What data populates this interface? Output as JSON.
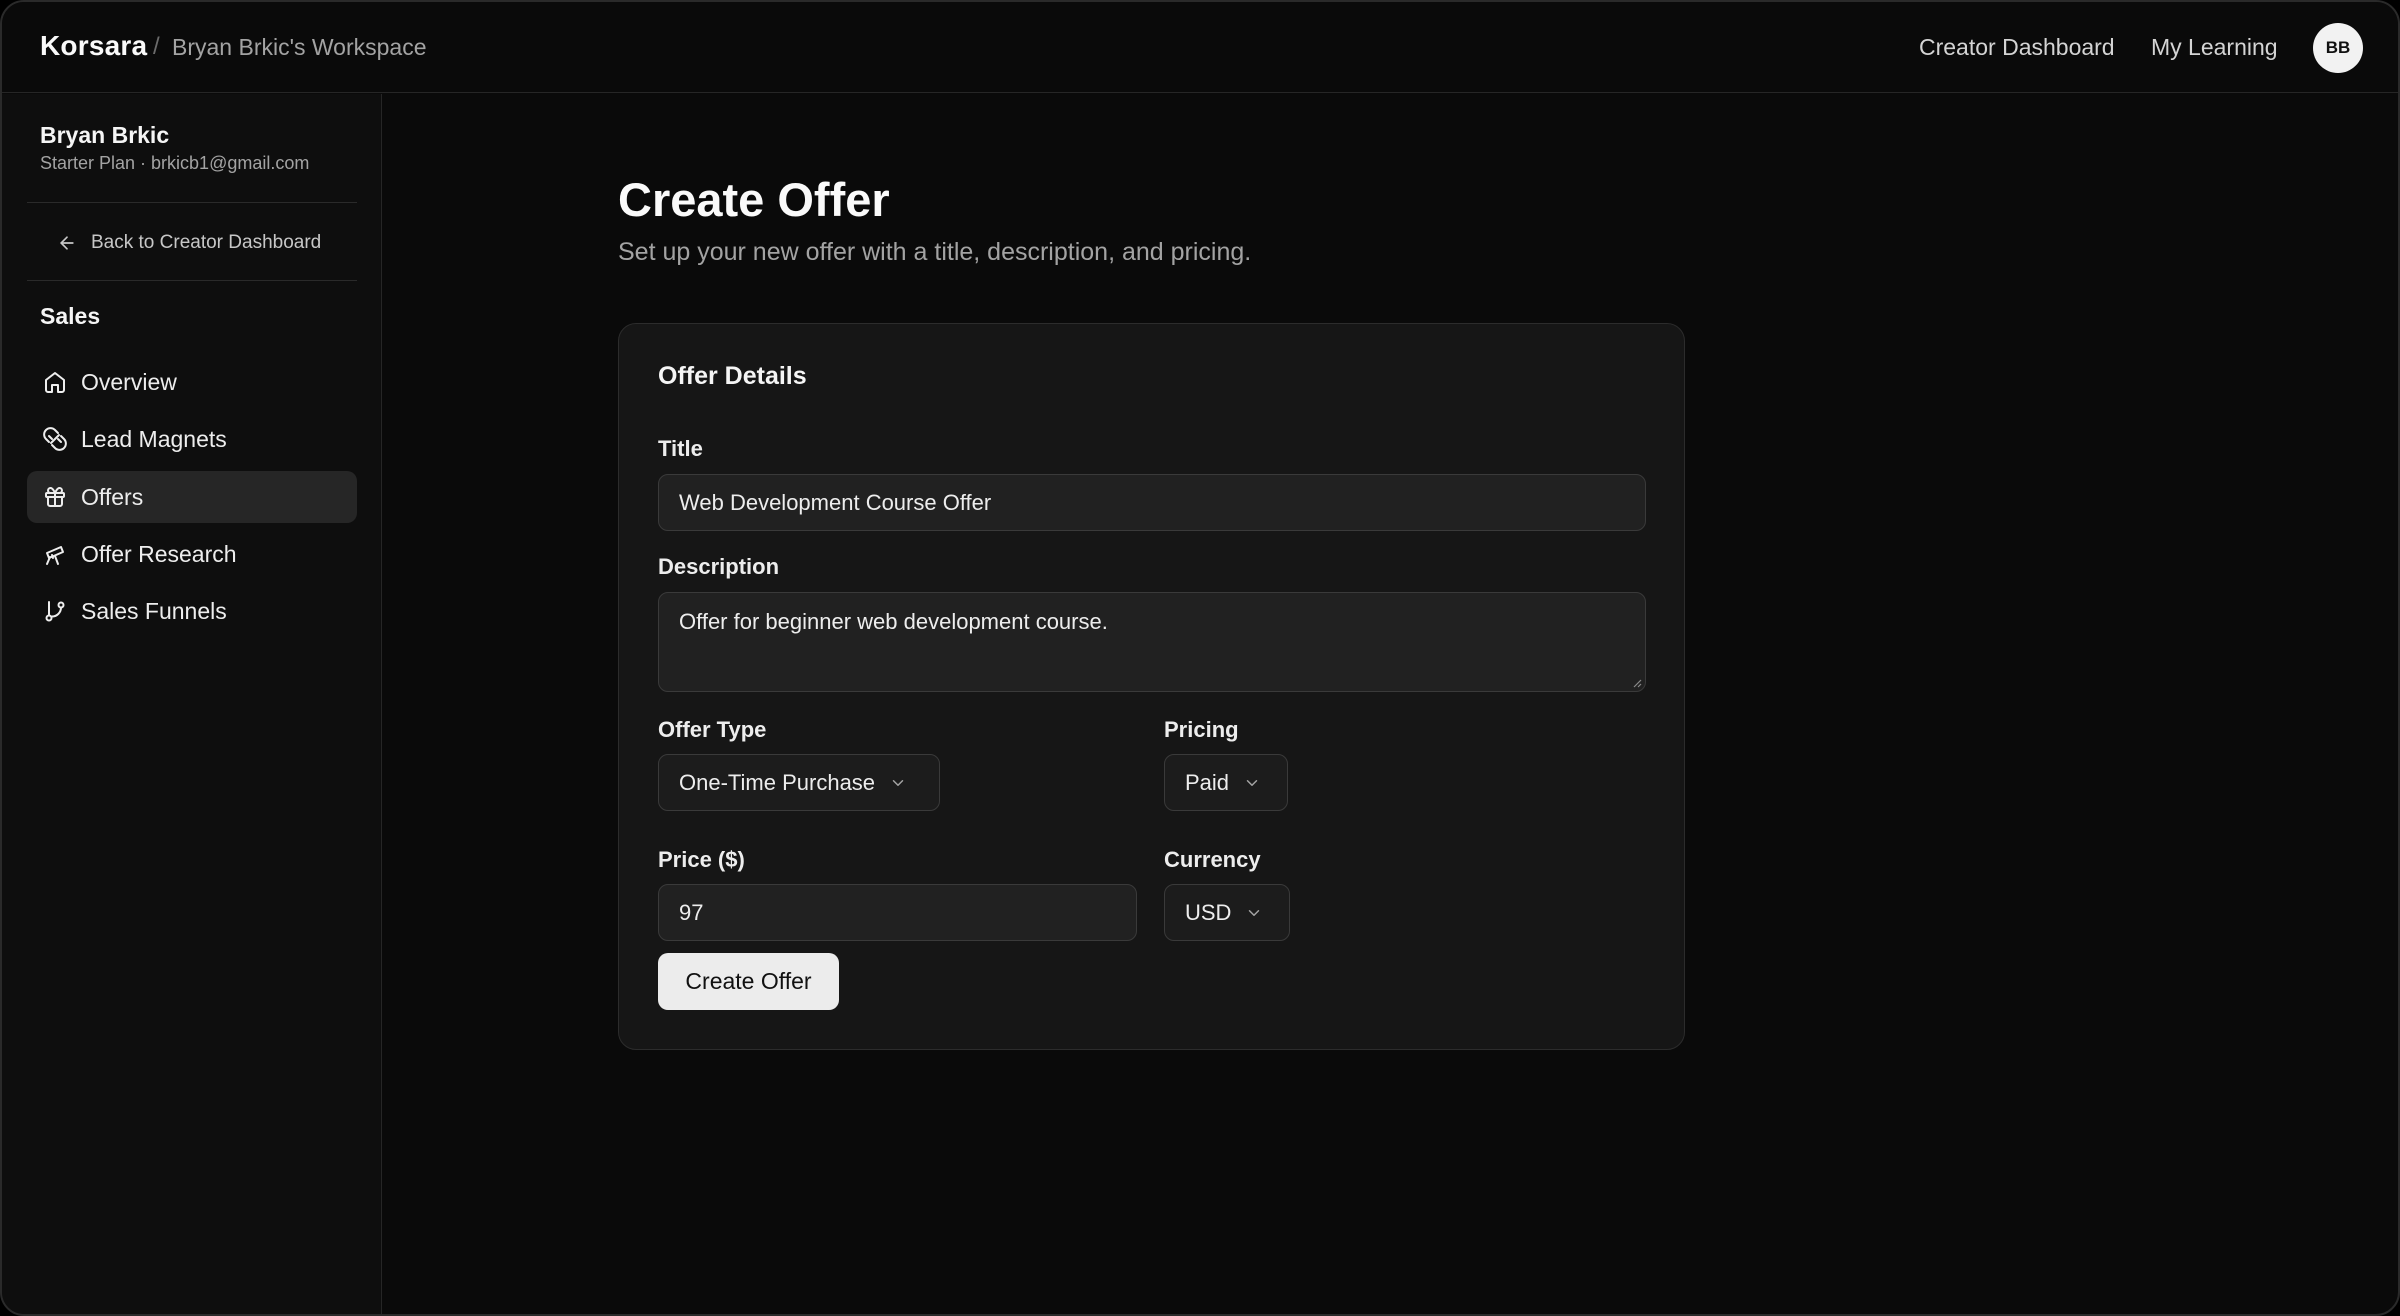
{
  "header": {
    "brand": "Korsara",
    "separator": "/",
    "workspace": "Bryan Brkic's Workspace",
    "nav": {
      "creator_dashboard": "Creator Dashboard",
      "my_learning": "My Learning"
    },
    "avatar_initials": "BB"
  },
  "sidebar": {
    "user_name": "Bryan Brkic",
    "user_meta": "Starter Plan · brkicb1@gmail.com",
    "back_link": "Back to Creator Dashboard",
    "section_title": "Sales",
    "items": [
      {
        "label": "Overview",
        "icon": "home-icon",
        "active": false
      },
      {
        "label": "Lead Magnets",
        "icon": "magnet-icon",
        "active": false
      },
      {
        "label": "Offers",
        "icon": "gift-icon",
        "active": true
      },
      {
        "label": "Offer Research",
        "icon": "telescope-icon",
        "active": false
      },
      {
        "label": "Sales Funnels",
        "icon": "git-branch-icon",
        "active": false
      }
    ]
  },
  "main": {
    "title": "Create Offer",
    "subtitle": "Set up your new offer with a title, description, and pricing.",
    "card": {
      "title": "Offer Details",
      "fields": {
        "title_label": "Title",
        "title_value": "Web Development Course Offer",
        "description_label": "Description",
        "description_value": "Offer for beginner web development course.",
        "offer_type_label": "Offer Type",
        "offer_type_value": "One-Time Purchase",
        "pricing_label": "Pricing",
        "pricing_value": "Paid",
        "price_label": "Price ($)",
        "price_value": "97",
        "currency_label": "Currency",
        "currency_value": "USD"
      },
      "submit_label": "Create Offer"
    }
  },
  "colors": {
    "background": "#0a0a0a",
    "card": "#161616",
    "primary_button": "#ececec",
    "active_nav": "#262626"
  }
}
